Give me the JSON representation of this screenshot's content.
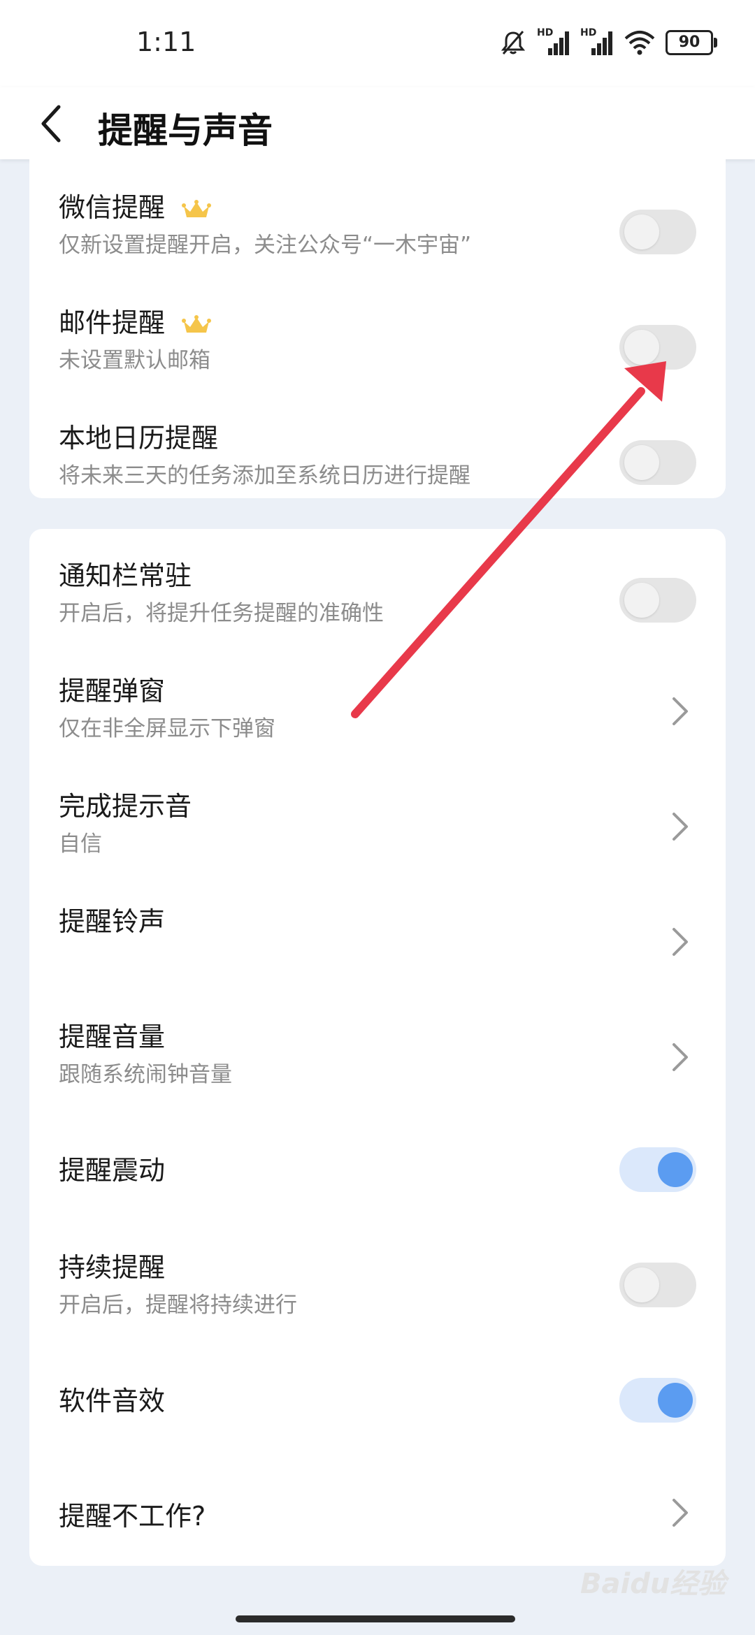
{
  "status_bar": {
    "time": "1:11",
    "battery": "90",
    "hd1": "HD",
    "hd2": "HD",
    "icons": [
      "mute-icon",
      "signal-icon",
      "signal-icon",
      "wifi-icon",
      "battery-icon"
    ]
  },
  "app_bar": {
    "title": "提醒与声音",
    "back_icon": "chevron-left-icon"
  },
  "group1": [
    {
      "label": "微信提醒",
      "sub": "仅新设置提醒开启，关注公众号“一木宇宙”",
      "control": "toggle",
      "on": false,
      "premium": true
    },
    {
      "label": "邮件提醒",
      "sub": "未设置默认邮箱",
      "control": "toggle",
      "on": false,
      "premium": true
    },
    {
      "label": "本地日历提醒",
      "sub": "将未来三天的任务添加至系统日历进行提醒",
      "control": "toggle",
      "on": false
    }
  ],
  "group2": [
    {
      "label": "通知栏常驻",
      "sub": "开启后，将提升任务提醒的准确性",
      "control": "toggle",
      "on": false
    },
    {
      "label": "提醒弹窗",
      "sub": "仅在非全屏显示下弹窗",
      "control": "chevron"
    },
    {
      "label": "完成提示音",
      "sub": "自信",
      "control": "chevron"
    },
    {
      "label": "提醒铃声",
      "sub": "",
      "control": "chevron"
    },
    {
      "label": "提醒音量",
      "sub": "跟随系统闹钟音量",
      "control": "chevron"
    },
    {
      "label": "提醒震动",
      "sub": "",
      "control": "toggle",
      "on": true
    },
    {
      "label": "持续提醒",
      "sub": "开启后，提醒将持续进行",
      "control": "toggle",
      "on": false
    },
    {
      "label": "软件音效",
      "sub": "",
      "control": "toggle",
      "on": true
    },
    {
      "label": "提醒不工作?",
      "sub": "",
      "control": "chevron"
    }
  ],
  "colors": {
    "accent": "#5b9cf1",
    "annotation_arrow": "#e8394a",
    "background": "#ebf0f7"
  },
  "watermark": "Baidu经验"
}
